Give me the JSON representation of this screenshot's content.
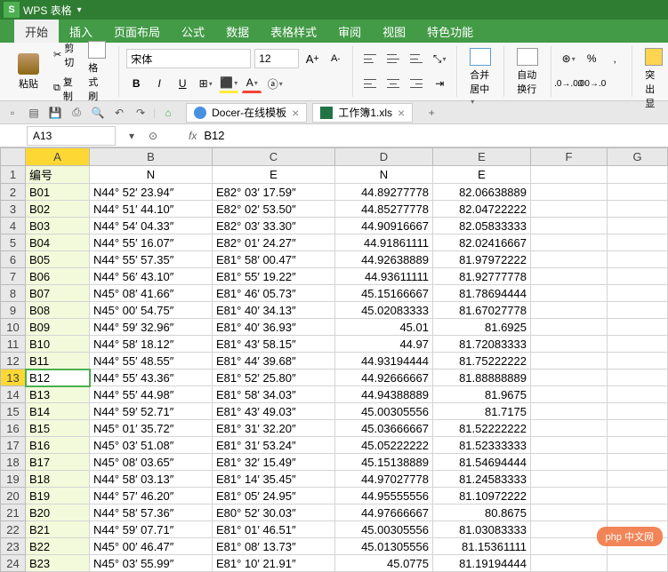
{
  "app": {
    "logo": "S",
    "title": "WPS 表格"
  },
  "menu": [
    "开始",
    "插入",
    "页面布局",
    "公式",
    "数据",
    "表格样式",
    "审阅",
    "视图",
    "特色功能"
  ],
  "menu_active": 0,
  "ribbon": {
    "paste": "粘贴",
    "cut": "剪切",
    "copy": "复制",
    "format_painter": "格式刷",
    "font_name": "宋体",
    "font_size": "12",
    "merge": "合并居中",
    "wrap": "自动换行",
    "overflow": "突出显"
  },
  "qa": {
    "tabs": [
      {
        "icon": "docer",
        "label": "Docer-在线模板"
      },
      {
        "icon": "excel",
        "label": "工作簿1.xls"
      }
    ]
  },
  "namebox": {
    "cell": "A13",
    "fx": "fx",
    "formula": "B12"
  },
  "cols": [
    "A",
    "B",
    "C",
    "D",
    "E",
    "F",
    "G"
  ],
  "headers": {
    "A": "编号",
    "B": "N",
    "C": "E",
    "D": "N",
    "E": "E"
  },
  "rows": [
    [
      "B01",
      "N44° 52′ 23.94″",
      "E82° 03′ 17.59″",
      "44.89277778",
      "82.06638889"
    ],
    [
      "B02",
      "N44° 51′ 44.10″",
      "E82° 02′ 53.50″",
      "44.85277778",
      "82.04722222"
    ],
    [
      "B03",
      "N44° 54′ 04.33″",
      "E82° 03′ 33.30″",
      "44.90916667",
      "82.05833333"
    ],
    [
      "B04",
      "N44° 55′ 16.07″",
      "E82° 01′ 24.27″",
      "44.91861111",
      "82.02416667"
    ],
    [
      "B05",
      "N44° 55′ 57.35″",
      "E81° 58′ 00.47″",
      "44.92638889",
      "81.97972222"
    ],
    [
      "B06",
      "N44° 56′ 43.10″",
      "E81° 55′ 19.22″",
      "44.93611111",
      "81.92777778"
    ],
    [
      "B07",
      "N45° 08′ 41.66″",
      "E81° 46′ 05.73″",
      "45.15166667",
      "81.78694444"
    ],
    [
      "B08",
      "N45° 00′ 54.75″",
      "E81° 40′ 34.13″",
      "45.02083333",
      "81.67027778"
    ],
    [
      "B09",
      "N44° 59′ 32.96″",
      "E81° 40′ 36.93″",
      "45.01",
      "81.6925"
    ],
    [
      "B10",
      "N44° 58′ 18.12″",
      "E81° 43′ 58.15″",
      "44.97",
      "81.72083333"
    ],
    [
      "B11",
      "N44° 55′ 48.55″",
      "E81° 44′ 39.68″",
      "44.93194444",
      "81.75222222"
    ],
    [
      "B12",
      "N44° 55′ 43.36″",
      "E81° 52′ 25.80″",
      "44.92666667",
      "81.88888889"
    ],
    [
      "B13",
      "N44° 55′ 44.98″",
      "E81° 58′ 34.03″",
      "44.94388889",
      "81.9675"
    ],
    [
      "B14",
      "N44° 59′ 52.71″",
      "E81° 43′ 49.03″",
      "45.00305556",
      "81.7175"
    ],
    [
      "B15",
      "N45° 01′ 35.72″",
      "E81° 31′ 32.20″",
      "45.03666667",
      "81.52222222"
    ],
    [
      "B16",
      "N45° 03′ 51.08″",
      "E81° 31′ 53.24″",
      "45.05222222",
      "81.52333333"
    ],
    [
      "B17",
      "N45° 08′ 03.65″",
      "E81° 32′ 15.49″",
      "45.15138889",
      "81.54694444"
    ],
    [
      "B18",
      "N44° 58′ 03.13″",
      "E81° 14′ 35.45″",
      "44.97027778",
      "81.24583333"
    ],
    [
      "B19",
      "N44° 57′ 46.20″",
      "E81° 05′ 24.95″",
      "44.95555556",
      "81.10972222"
    ],
    [
      "B20",
      "N44° 58′ 57.36″",
      "E80° 52′ 30.03″",
      "44.97666667",
      "80.8675"
    ],
    [
      "B21",
      "N44° 59′ 07.71″",
      "E81° 01′ 46.51″",
      "45.00305556",
      "81.03083333"
    ],
    [
      "B22",
      "N45° 00′ 46.47″",
      "E81° 08′ 13.73″",
      "45.01305556",
      "81.15361111"
    ],
    [
      "B23",
      "N45° 03′ 55.99″",
      "E81° 10′ 21.91″",
      "45.0775",
      "81.19194444"
    ]
  ],
  "active_cell": {
    "row": 13,
    "col": 0
  },
  "watermark": "php 中文网"
}
